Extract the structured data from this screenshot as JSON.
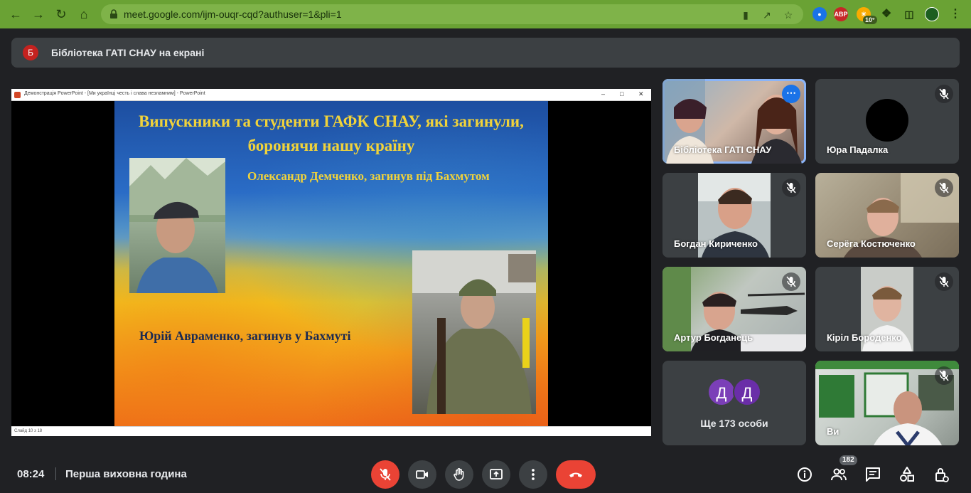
{
  "browser": {
    "url": "meet.google.com/ijm-ouqr-cqd?authuser=1&pli=1",
    "ext_abp_label": "ABP",
    "weather_temp": "10°",
    "colors": {
      "chrome_bg": "#6aa234",
      "omnibox_bg": "#7fb349"
    }
  },
  "banner": {
    "avatar_letter": "Б",
    "text": "Бібліотека ГАТІ СНАУ на екрані"
  },
  "presentation": {
    "window_title": "Демонстрація PowerPoint - [Ми українці честь і слава незламним] - PowerPoint",
    "slide_heading": "Випускники та студенти ГАФК СНАУ, які загинули, боронячи нашу країну",
    "caption_1": "Олександр Демченко, загинув під Бахмутом",
    "caption_2": "Юрій Авраменко, загинув у Бахмуті",
    "status_text": "Слайд 10 з 18"
  },
  "participants": [
    {
      "name": "Бібліотека ГАТІ СНАУ",
      "muted": false,
      "active": true
    },
    {
      "name": "Юра Падалка",
      "muted": true
    },
    {
      "name": "Богдан Кириченко",
      "muted": true
    },
    {
      "name": "Серёга Костюченко",
      "muted": true
    },
    {
      "name": "Артур Богданець",
      "muted": true
    },
    {
      "name": "Кірiл Бороденко",
      "muted": true
    },
    {
      "name": "Ви",
      "muted": true
    }
  ],
  "others": {
    "avatar_1": "Д",
    "avatar_2": "Д",
    "label": "Ще 173 особи",
    "colors": {
      "avatar_1": "#7b3fb8",
      "avatar_2": "#6a2ea8"
    }
  },
  "bottom": {
    "time": "08:24",
    "meeting_title": "Перша виховна година",
    "people_count": "182"
  },
  "colors": {
    "bg": "#202124",
    "tile": "#3c4043",
    "danger": "#ea4335",
    "active_outline": "#8ab4f8",
    "accent": "#1a73e8"
  }
}
